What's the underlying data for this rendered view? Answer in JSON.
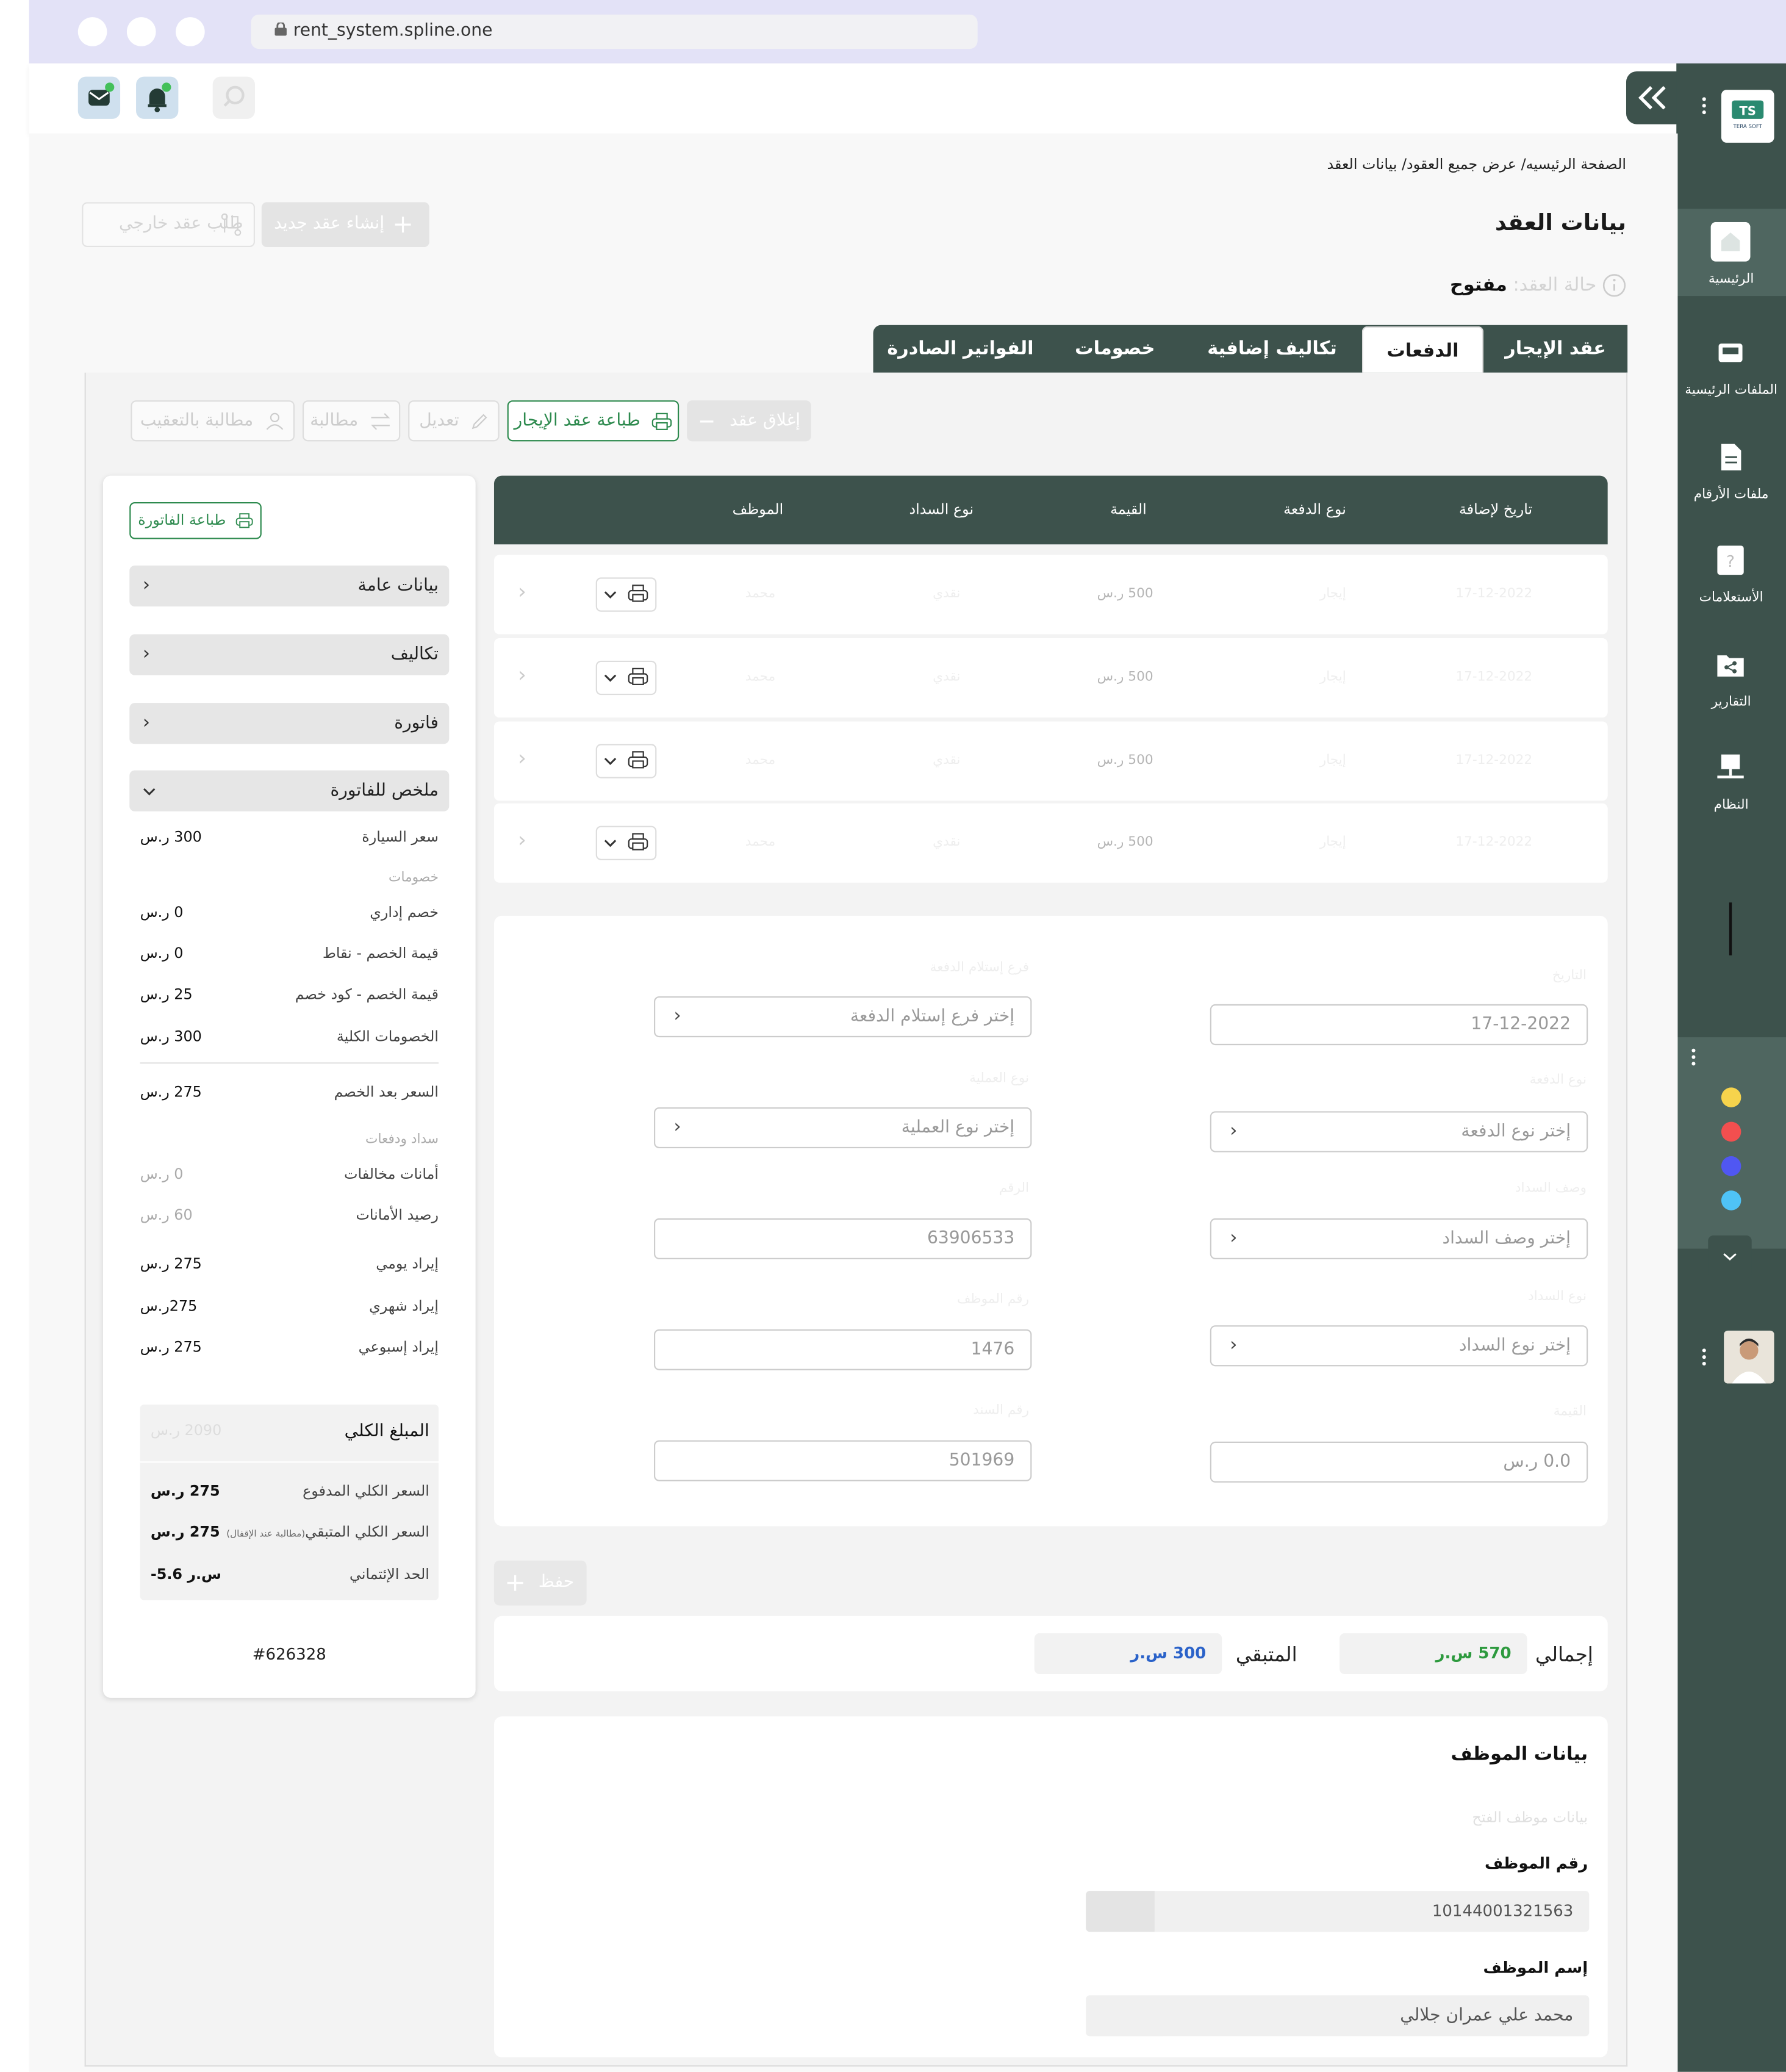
{
  "browser": {
    "url": "rent_system.spline.one"
  },
  "sidebar": {
    "logo_text": "TERA SOFT",
    "items": [
      {
        "label": "الرئيسية",
        "icon": "home-icon"
      },
      {
        "label": "الملفات الرئيسية",
        "icon": "inbox-icon"
      },
      {
        "label": "ملفات الأرقام",
        "icon": "file-icon"
      },
      {
        "label": "الأستعلامات",
        "icon": "question-icon"
      },
      {
        "label": "التقارير",
        "icon": "share-folder-icon"
      },
      {
        "label": "النظام",
        "icon": "network-icon"
      }
    ],
    "theme_colors": [
      "#f6d34c",
      "#f24f4f",
      "#5057f2",
      "#4fc3f7"
    ]
  },
  "breadcrumb": "الصفحة الرئيسيه/ عرض جميع العقود/ بيانات العقد",
  "header_buttons": {
    "external_contract": "طلب عقد خارجي",
    "new_contract": "إنشاء عقد جديد"
  },
  "page_title": "بيانات العقد",
  "contract_status": {
    "label": "حالة العقد:",
    "value": "مفتوح"
  },
  "tabs": [
    {
      "label": "عقد الإيجار",
      "active": false
    },
    {
      "label": "الدفعات",
      "active": true
    },
    {
      "label": "تكاليف إضافية",
      "active": false
    },
    {
      "label": "خصومات",
      "active": false
    },
    {
      "label": "الفواتير الصادرة",
      "active": false
    }
  ],
  "toolbar": {
    "close_contract": "إغلاق عقد",
    "print_contract": "طباعة عقد الإيجار",
    "edit": "تعديل",
    "claim": "مطالبة",
    "claim_followup": "مطالبة بالتعقيب"
  },
  "invoice_panel": {
    "print_invoice": "طباعة الفاتورة",
    "sections": [
      "بيانات عامة",
      "تكاليف",
      "فاتورة",
      "ملخص للفاتورة"
    ],
    "car_price": {
      "label": "سعر السيارة",
      "value": "300 ر.س"
    },
    "discounts_header": "خصومات",
    "admin_discount": {
      "label": "خصم إداري",
      "value": "0 ر.س"
    },
    "points_discount": {
      "label": "قيمة الخصم - نقاط",
      "value": "0 ر.س"
    },
    "code_discount": {
      "label": "قيمة الخصم - كود خصم",
      "value": "25 ر.س"
    },
    "total_discounts": {
      "label": "الخصومات الكلية",
      "value": "300 ر.س"
    },
    "price_after_discount": {
      "label": "السعر بعد الخصم",
      "value": "275 ر.س"
    },
    "payments_header": "سداد ودفعات",
    "violation_deposits": {
      "label": "أمانات مخالفات",
      "value": "0 ر.س"
    },
    "deposit_balance": {
      "label": "رصيد الأمانات",
      "value": "60 ر.س"
    },
    "daily_revenue": {
      "label": "إيراد يومي",
      "value": "275 ر.س"
    },
    "monthly_revenue": {
      "label": "إيراد شهري",
      "value": "275ر.س"
    },
    "weekly_revenue": {
      "label": "إيراد إسبوعي",
      "value": "275 ر.س"
    },
    "total_amount": {
      "label": "المبلغ الكلي",
      "value": "2090 ر.س"
    },
    "total_paid": {
      "label": "السعر الكلي المدفوع",
      "value": "275 ر.س"
    },
    "total_remaining": {
      "label": "السعر الكلي المتبقي",
      "note": "(مطالبة عند الإقفال)",
      "value": "275 ر.س"
    },
    "credit_limit": {
      "label": "الحد الإئتماني",
      "value": "-5.6 س.ر"
    },
    "invoice_number": "#626328"
  },
  "payments_table": {
    "columns": [
      "تاريخ لإضافة",
      "نوع الدفعة",
      "القيمة",
      "نوع السداد",
      "الموظف"
    ],
    "rows": [
      {
        "date": "17-12-2022",
        "type": "إيجار",
        "amount": "500 ر.س",
        "method": "نقدي",
        "employee": "محمد"
      },
      {
        "date": "17-12-2022",
        "type": "إيجار",
        "amount": "500 ر.س",
        "method": "نقدي",
        "employee": "محمد"
      },
      {
        "date": "17-12-2022",
        "type": "إيجار",
        "amount": "500 ر.س",
        "method": "نقدي",
        "employee": "محمد"
      },
      {
        "date": "17-12-2022",
        "type": "إيجار",
        "amount": "500 ر.س",
        "method": "نقدي",
        "employee": "محمد"
      }
    ]
  },
  "payment_form": {
    "date": {
      "label": "التاريخ",
      "value": "17-12-2022"
    },
    "branch": {
      "label": "فرع إستلام الدفعة",
      "placeholder": "إختر فرع إستلام الدفعة"
    },
    "payment_type": {
      "label": "نوع الدفعة",
      "placeholder": "إختر نوع الدفعة"
    },
    "operation_type": {
      "label": "نوع العملية",
      "placeholder": "إختر نوع العملية"
    },
    "payment_desc": {
      "label": "وصف السداد",
      "placeholder": "إختر وصف السداد"
    },
    "field_a": {
      "label": "الرقم",
      "value": "63906533"
    },
    "payment_method": {
      "label": "نوع السداد",
      "placeholder": "إختر نوع السداد"
    },
    "field_b": {
      "label": "رقم الموظف",
      "value": "1476"
    },
    "amount": {
      "label": "القيمة",
      "value": "0.0 ر.س"
    },
    "field_c": {
      "label": "رقم السند",
      "value": "501969"
    },
    "save_button": "حفظ"
  },
  "totals": {
    "total_label": "إجمالي",
    "total_value": "570 س.ر",
    "remaining_label": "المتبقي",
    "remaining_value": "300 س.ر"
  },
  "employee": {
    "title": "بيانات الموظف",
    "subtitle": "بيانات موظف الفتح",
    "number_label": "رقم الموظف",
    "number_value": "10144001321563",
    "name_label": "إسم الموظف",
    "name_value": "محمد علي عمران جلالي"
  }
}
